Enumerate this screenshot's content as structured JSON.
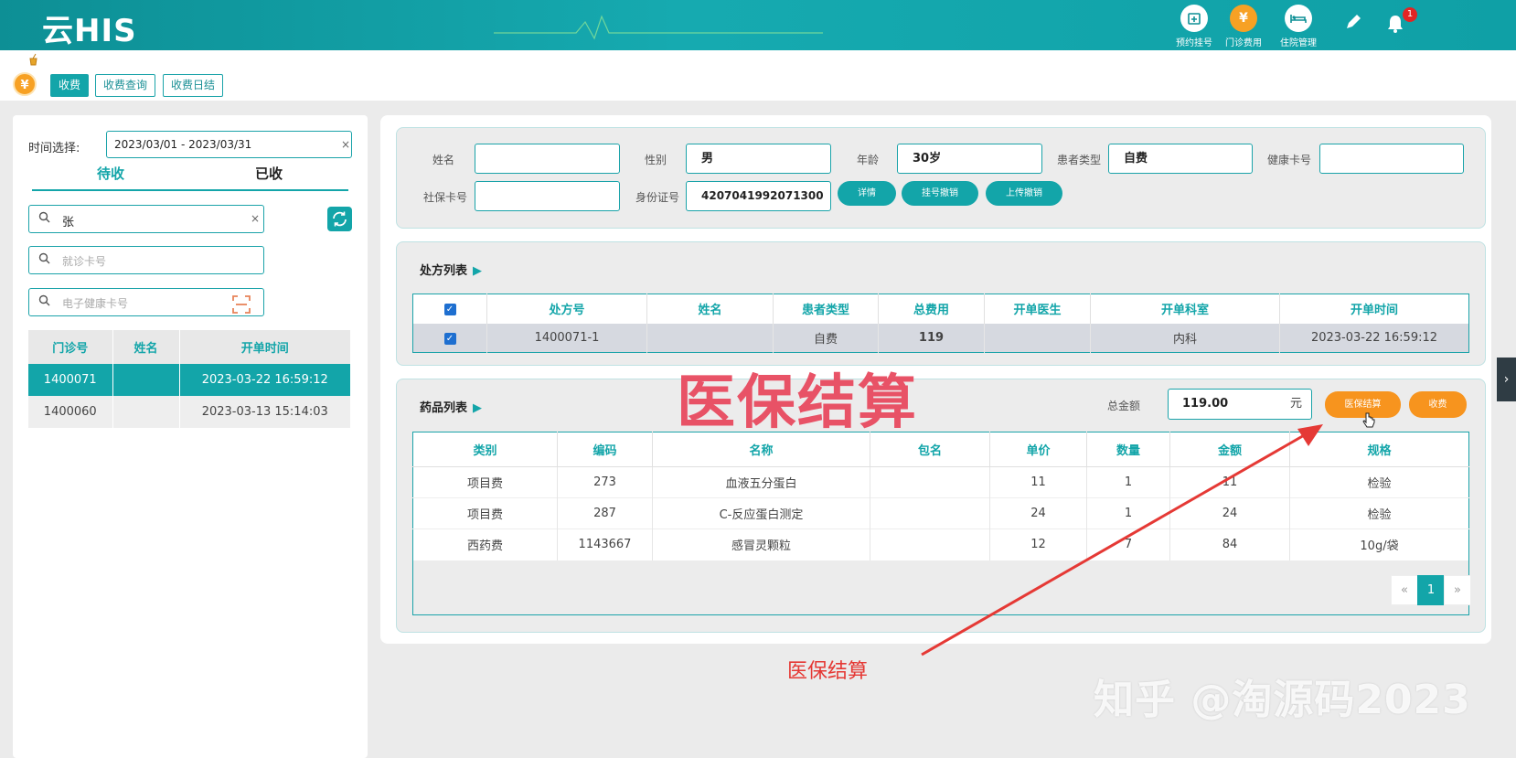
{
  "header": {
    "logo": "云HIS",
    "nav": [
      {
        "label": "预约挂号",
        "icon": "calendar-plus-icon"
      },
      {
        "label": "门诊费用",
        "icon": "yen-icon"
      },
      {
        "label": "住院管理",
        "icon": "bed-icon"
      }
    ],
    "notification_count": "1"
  },
  "toolbar": {
    "tabs": [
      "收费",
      "收费查询",
      "收费日结"
    ],
    "active_tab": "收费",
    "yen_symbol": "¥"
  },
  "left": {
    "date_label": "时间选择:",
    "date_range": "2023/03/01 - 2023/03/31",
    "tab_pending": "待收",
    "tab_done": "已收",
    "search_name_value": "张",
    "search_card_placeholder": "就诊卡号",
    "search_health_placeholder": "电子健康卡号",
    "table": {
      "headers": [
        "门诊号",
        "姓名",
        "开单时间"
      ],
      "rows": [
        {
          "no": "1400071",
          "name": "",
          "time": "2023-03-22 16:59:12"
        },
        {
          "no": "1400060",
          "name": "",
          "time": "2023-03-13 15:14:03"
        }
      ]
    }
  },
  "patient": {
    "name_label": "姓名",
    "name_value": "",
    "gender_label": "性别",
    "gender_value": "男",
    "age_label": "年龄",
    "age_value": "30岁",
    "type_label": "患者类型",
    "type_value": "自费",
    "health_card_label": "健康卡号",
    "health_card_value": "",
    "social_card_label": "社保卡号",
    "social_card_value": "",
    "id_label": "身份证号",
    "id_value": "4207041992071300",
    "btn_detail": "详情",
    "btn_cancel_reg": "挂号撤销",
    "btn_upload_cancel": "上传撤销"
  },
  "prescriptions": {
    "title": "处方列表",
    "headers": [
      "处方号",
      "姓名",
      "患者类型",
      "总费用",
      "开单医生",
      "开单科室",
      "开单时间"
    ],
    "rows": [
      {
        "no": "1400071-1",
        "name": "",
        "type": "自费",
        "total": "119",
        "doctor": "",
        "dept": "内科",
        "time": "2023-03-22 16:59:12"
      }
    ]
  },
  "drugs": {
    "title": "药品列表",
    "total_label": "总金额",
    "total_value": "119.00",
    "total_unit": "元",
    "btn_insurance": "医保结算",
    "btn_charge": "收费",
    "headers": [
      "类别",
      "编码",
      "名称",
      "包名",
      "单价",
      "数量",
      "金额",
      "规格"
    ],
    "rows": [
      {
        "cat": "项目费",
        "code": "273",
        "name": "血液五分蛋白",
        "pkg": "",
        "price": "11",
        "qty": "1",
        "amount": "11",
        "spec": "检验"
      },
      {
        "cat": "项目费",
        "code": "287",
        "name": "C-反应蛋白测定",
        "pkg": "",
        "price": "24",
        "qty": "1",
        "amount": "24",
        "spec": "检验"
      },
      {
        "cat": "西药费",
        "code": "1143667",
        "name": "感冒灵颗粒",
        "pkg": "",
        "price": "12",
        "qty": "7",
        "amount": "84",
        "spec": "10g/袋"
      }
    ],
    "pager": {
      "prev": "«",
      "page": "1",
      "next": "»"
    }
  },
  "overlays": {
    "big_title": "医保结算",
    "annotation": "医保结算",
    "watermark": "知乎 @淘源码2023",
    "arrow_color": "#e53935"
  },
  "colors": {
    "primary": "#13a5a9",
    "accent": "#f7941e",
    "header_start": "#0d8f95"
  }
}
